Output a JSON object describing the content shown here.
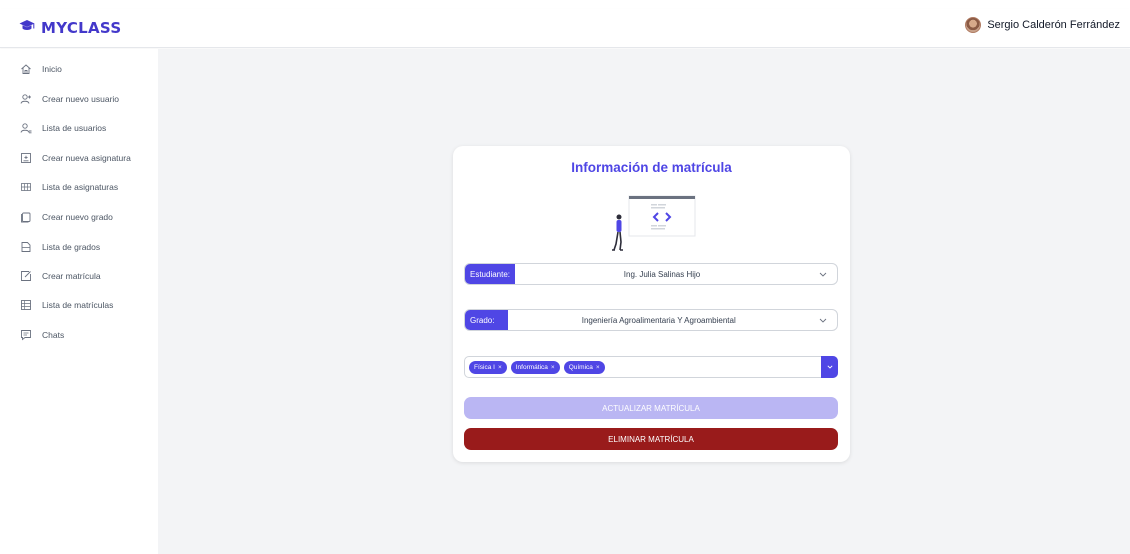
{
  "app": {
    "title": "MYCLASS",
    "brand_color": "#4338ca"
  },
  "user": {
    "name": "Sergio Calderón Ferrández"
  },
  "sidebar": {
    "items": [
      {
        "label": "Inicio",
        "icon": "home-icon"
      },
      {
        "label": "Crear nuevo usuario",
        "icon": "user-add-icon"
      },
      {
        "label": "Lista de usuarios",
        "icon": "users-icon"
      },
      {
        "label": "Crear nueva asignatura",
        "icon": "add-box-icon"
      },
      {
        "label": "Lista de asignaturas",
        "icon": "grid-list-icon"
      },
      {
        "label": "Crear nuevo grado",
        "icon": "copy-icon"
      },
      {
        "label": "Lista de grados",
        "icon": "document-icon"
      },
      {
        "label": "Crear matrícula",
        "icon": "edit-icon"
      },
      {
        "label": "Lista de matrículas",
        "icon": "table-icon"
      },
      {
        "label": "Chats",
        "icon": "chat-icon"
      }
    ]
  },
  "form": {
    "title": "Información de matrícula",
    "student": {
      "label": "Estudiante:",
      "value": "Ing. Julia Salinas Hijo"
    },
    "degree": {
      "label": "Grado:",
      "value": "Ingeniería Agroalimentaria Y Agroambiental"
    },
    "subjects": [
      "Física I",
      "Informática",
      "Química"
    ],
    "update_label": "ACTUALIZAR MATRÍCULA",
    "delete_label": "ELIMINAR MATRÍCULA"
  },
  "colors": {
    "accent": "#4f46e5",
    "update_disabled": "#bab6f3",
    "danger": "#991b1b",
    "background": "#f3f4f6"
  }
}
